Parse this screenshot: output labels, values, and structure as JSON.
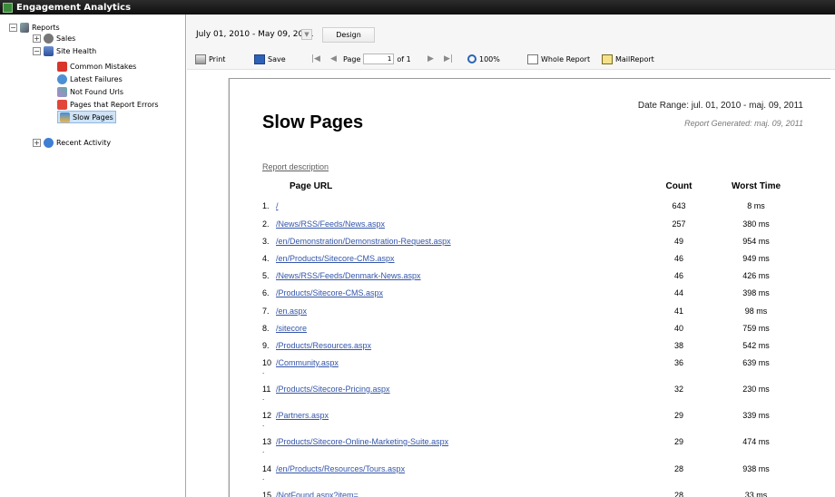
{
  "app": {
    "title": "Engagement Analytics"
  },
  "tree": {
    "reports": "Reports",
    "sales": "Sales",
    "site_health": "Site Health",
    "common_mistakes": "Common Mistakes",
    "latest_failures": "Latest Failures",
    "not_found_urls": "Not Found Urls",
    "pages_errors": "Pages that Report Errors",
    "slow_pages": "Slow Pages",
    "recent_activity": "Recent Activity"
  },
  "toolbar": {
    "date_range_value": "July 01, 2010 - May 09, 2011",
    "design": "Design",
    "print": "Print",
    "save": "Save",
    "page_label": "Page",
    "page_value": "1",
    "page_of": "of 1",
    "zoom": "100%",
    "whole_report": "Whole Report",
    "mail_report": "MailReport"
  },
  "report": {
    "title": "Slow Pages",
    "date_range": "Date Range: jul. 01, 2010 - maj. 09, 2011",
    "generated": "Report Generated: maj. 09, 2011",
    "description_link": "Report description",
    "col_url": "Page URL",
    "col_count": "Count",
    "col_worst": "Worst Time",
    "rows": [
      {
        "num": "1.",
        "url": "/",
        "count": "643",
        "worst": "8 ms"
      },
      {
        "num": "2.",
        "url": "/News/RSS/Feeds/News.aspx",
        "count": "257",
        "worst": "380 ms"
      },
      {
        "num": "3.",
        "url": "/en/Demonstration/Demonstration-Request.aspx",
        "count": "49",
        "worst": "954 ms"
      },
      {
        "num": "4.",
        "url": "/en/Products/Sitecore-CMS.aspx",
        "count": "46",
        "worst": "949 ms"
      },
      {
        "num": "5.",
        "url": "/News/RSS/Feeds/Denmark-News.aspx",
        "count": "46",
        "worst": "426 ms"
      },
      {
        "num": "6.",
        "url": "/Products/Sitecore-CMS.aspx",
        "count": "44",
        "worst": "398 ms"
      },
      {
        "num": "7.",
        "url": "/en.aspx",
        "count": "41",
        "worst": "98 ms"
      },
      {
        "num": "8.",
        "url": "/sitecore",
        "count": "40",
        "worst": "759 ms"
      },
      {
        "num": "9.",
        "url": "/Products/Resources.aspx",
        "count": "38",
        "worst": "542 ms"
      },
      {
        "num": "10",
        "url": "/Community.aspx",
        "count": "36",
        "worst": "639 ms"
      },
      {
        "num": "11",
        "url": "/Products/Sitecore-Pricing.aspx",
        "count": "32",
        "worst": "230 ms"
      },
      {
        "num": "12",
        "url": "/Partners.aspx",
        "count": "29",
        "worst": "339 ms"
      },
      {
        "num": "13",
        "url": "/Products/Sitecore-Online-Marketing-Suite.aspx",
        "count": "29",
        "worst": "474 ms"
      },
      {
        "num": "14",
        "url": "/en/Products/Resources/Tours.aspx",
        "count": "28",
        "worst": "938 ms"
      },
      {
        "num": "15",
        "url": "/NotFound.aspx?item=",
        "count": "28",
        "worst": "33 ms"
      }
    ]
  }
}
